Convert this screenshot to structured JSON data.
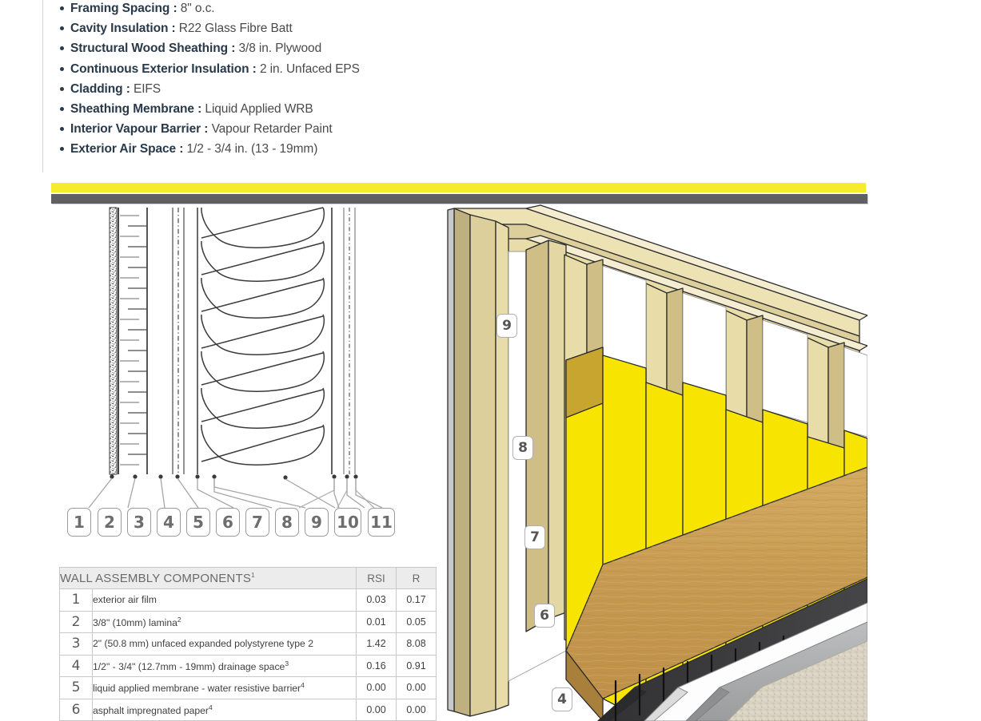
{
  "spec_list": [
    {
      "label": "Framing Spacing :",
      "value": "8\" o.c."
    },
    {
      "label": "Cavity Insulation :",
      "value": "R22 Glass Fibre Batt"
    },
    {
      "label": "Structural Wood Sheathing :",
      "value": "3/8 in. Plywood"
    },
    {
      "label": "Continuous Exterior Insulation :",
      "value": "2 in. Unfaced EPS"
    },
    {
      "label": "Cladding :",
      "value": "EIFS"
    },
    {
      "label": "Sheathing Membrane :",
      "value": "Liquid Applied WRB"
    },
    {
      "label": "Interior Vapour Barrier :",
      "value": "Vapour Retarder Paint"
    },
    {
      "label": "Exterior Air Space :",
      "value": "1/2 - 3/4 in. (13 - 19mm)"
    }
  ],
  "banner": {
    "yellow_color": "#F5EC2E",
    "grey_color": "#5F6062"
  },
  "diagram": {
    "callout_badges": [
      "1",
      "2",
      "3",
      "4",
      "5",
      "6",
      "7",
      "8",
      "9",
      "10",
      "11"
    ],
    "render_tags": [
      "9",
      "8",
      "7",
      "6",
      "4"
    ]
  },
  "table": {
    "header": {
      "title": "WALL ASSEMBLY COMPONENTS",
      "title_sup": "1",
      "rsi": "RSI",
      "r": "R"
    },
    "rows": [
      {
        "idx": "1",
        "desc": "exterior air film",
        "sup": "",
        "rsi": "0.03",
        "r": "0.17"
      },
      {
        "idx": "2",
        "desc": "3/8\" (10mm) lamina",
        "sup": "2",
        "rsi": "0.01",
        "r": "0.05"
      },
      {
        "idx": "3",
        "desc": "2\" (50.8 mm) unfaced expanded polystyrene type 2",
        "sup": "",
        "rsi": "1.42",
        "r": "8.08"
      },
      {
        "idx": "4",
        "desc": "1/2\" - 3/4\" (12.7mm - 19mm) drainage space",
        "sup": "3",
        "rsi": "0.16",
        "r": "0.91"
      },
      {
        "idx": "5",
        "desc": "liquid applied membrane - water resistive barrier",
        "sup": "4",
        "rsi": "0.00",
        "r": "0.00"
      },
      {
        "idx": "6",
        "desc": "asphalt impregnated paper",
        "sup": "4",
        "rsi": "0.00",
        "r": "0.00"
      }
    ]
  },
  "colors": {
    "label_text": "#28394a",
    "value_text": "#4a4a4a",
    "table_border": "#c9c9c9",
    "table_header_bg": "#ececec",
    "insulation_yellow": "#F7E400",
    "lumber_light": "#E8DCA8",
    "lumber_mid": "#CFBE86",
    "plywood": "#C49A54",
    "drainmat_dark": "#3B3B3D",
    "eps_white": "#FDFDFD",
    "basecoat_grey": "#A7A9AC",
    "stucco_beige": "#D8D2C2"
  }
}
